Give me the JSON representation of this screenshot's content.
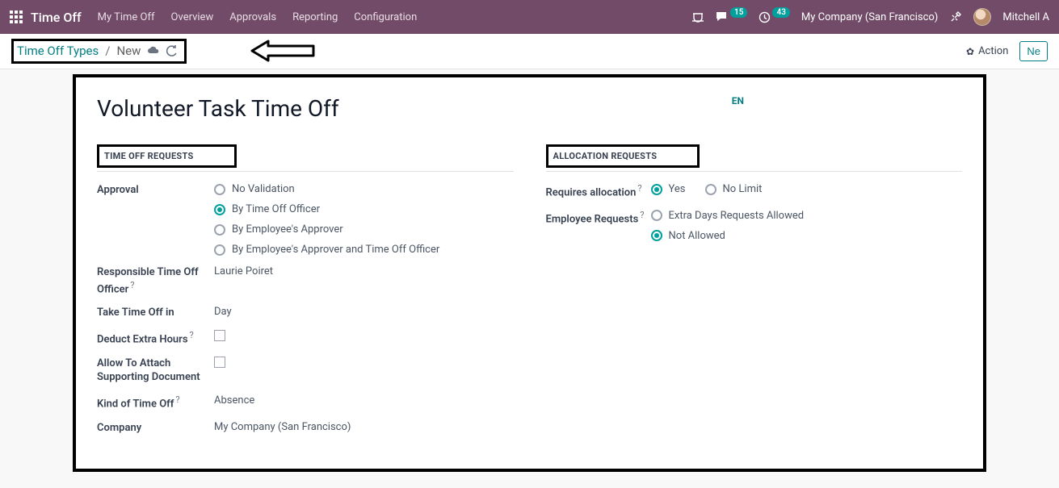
{
  "topbar": {
    "brand": "Time Off",
    "nav": [
      "My Time Off",
      "Overview",
      "Approvals",
      "Reporting",
      "Configuration"
    ],
    "msg_count": "15",
    "act_count": "43",
    "company": "My Company (San Francisco)",
    "user": "Mitchell A"
  },
  "breadcrumb": {
    "root": "Time Off Types",
    "sep": "/",
    "current": "New"
  },
  "actions": {
    "action_label": "Action",
    "new_label": "Ne"
  },
  "record": {
    "title": "Volunteer Task Time Off",
    "lang": "EN"
  },
  "left": {
    "section": "TIME OFF REQUESTS",
    "approval_label": "Approval",
    "approval_opts": [
      "No Validation",
      "By Time Off Officer",
      "By Employee's Approver",
      "By Employee's Approver and Time Off Officer"
    ],
    "officer_label": "Responsible Time Off Officer",
    "officer_value": "Laurie Poiret",
    "unit_label": "Take Time Off in",
    "unit_value": "Day",
    "deduct_label": "Deduct Extra Hours",
    "attach_label": "Allow To Attach Supporting Document",
    "kind_label": "Kind of Time Off",
    "kind_value": "Absence",
    "company_label": "Company",
    "company_value": "My Company (San Francisco)"
  },
  "right": {
    "section": "ALLOCATION REQUESTS",
    "req_label": "Requires allocation",
    "req_opts": [
      "Yes",
      "No Limit"
    ],
    "emp_label": "Employee Requests",
    "emp_opts": [
      "Extra Days Requests Allowed",
      "Not Allowed"
    ]
  }
}
